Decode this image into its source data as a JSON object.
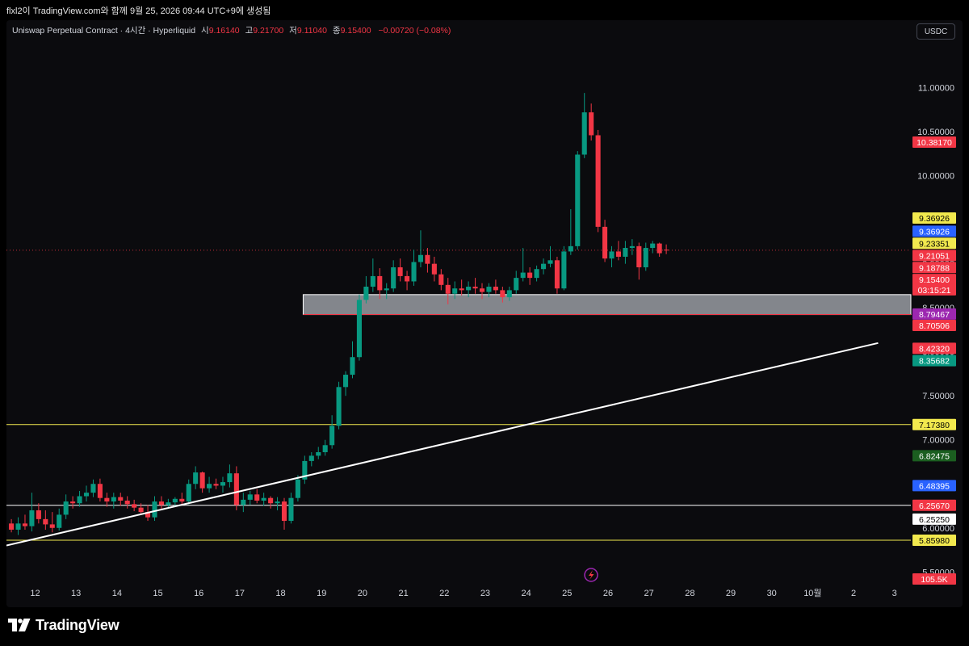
{
  "header": {
    "caption": "flxl2이 TradingView.com와 함께 9월 25, 2026 09:44 UTC+9에 생성됨"
  },
  "legend": {
    "symbol": "Uniswap Perpetual Contract · 4시간 · Hyperliquid",
    "open_label": "시",
    "open_value": "9.16140",
    "high_label": "고",
    "high_value": "9.21700",
    "low_label": "저",
    "low_value": "9.11040",
    "close_label": "종",
    "close_value": "9.15400",
    "change": "−0.00720 (−0.08%)"
  },
  "currency_button": "USDC",
  "footer": {
    "brand": "TradingView"
  },
  "chart_data": {
    "type": "candlestick",
    "title": "Uniswap Perpetual Contract · 4시간 · Hyperliquid",
    "x_ticks": [
      "12",
      "13",
      "14",
      "15",
      "16",
      "17",
      "18",
      "19",
      "20",
      "21",
      "22",
      "23",
      "24",
      "25",
      "26",
      "27",
      "28",
      "29",
      "30",
      "10월",
      "2",
      "3"
    ],
    "y_ticks": [
      "11.00000",
      "10.50000",
      "10.00000",
      "9.50000",
      "9.00000",
      "8.50000",
      "8.00000",
      "7.50000",
      "7.00000",
      "6.50000",
      "6.00000",
      "5.50000"
    ],
    "y_tick_values": [
      11.0,
      10.5,
      10.0,
      9.5,
      9.0,
      8.5,
      8.0,
      7.5,
      7.0,
      6.5,
      6.0,
      5.5
    ],
    "ylim": [
      5.42,
      11.4
    ],
    "xlim": [
      11.3,
      33.4
    ],
    "x_day_values": [
      12,
      13,
      14,
      15,
      16,
      17,
      18,
      19,
      20,
      21,
      22,
      23,
      24,
      25,
      26,
      27,
      28,
      29,
      30,
      31,
      32,
      33
    ],
    "candle_step_days": 0.1667,
    "first_candle_day": 11.42,
    "up_color": "#089981",
    "down_color": "#f23645",
    "ohlc": [
      [
        6.05,
        6.1,
        5.95,
        5.98
      ],
      [
        5.98,
        6.12,
        5.92,
        6.05
      ],
      [
        6.05,
        6.15,
        5.98,
        6.02
      ],
      [
        6.02,
        6.4,
        5.96,
        6.2
      ],
      [
        6.2,
        6.28,
        6.05,
        6.1
      ],
      [
        6.1,
        6.2,
        5.98,
        6.04
      ],
      [
        6.04,
        6.18,
        5.95,
        6.0
      ],
      [
        6.0,
        6.22,
        5.97,
        6.15
      ],
      [
        6.15,
        6.38,
        6.1,
        6.3
      ],
      [
        6.3,
        6.36,
        6.22,
        6.28
      ],
      [
        6.28,
        6.42,
        6.24,
        6.36
      ],
      [
        6.36,
        6.48,
        6.3,
        6.4
      ],
      [
        6.4,
        6.55,
        6.35,
        6.5
      ],
      [
        6.5,
        6.56,
        6.3,
        6.34
      ],
      [
        6.34,
        6.4,
        6.24,
        6.3
      ],
      [
        6.3,
        6.4,
        6.22,
        6.35
      ],
      [
        6.35,
        6.4,
        6.25,
        6.31
      ],
      [
        6.31,
        6.36,
        6.22,
        6.27
      ],
      [
        6.27,
        6.32,
        6.19,
        6.23
      ],
      [
        6.23,
        6.28,
        6.15,
        6.18
      ],
      [
        6.18,
        6.26,
        6.08,
        6.12
      ],
      [
        6.12,
        6.36,
        6.08,
        6.3
      ],
      [
        6.3,
        6.36,
        6.2,
        6.26
      ],
      [
        6.26,
        6.33,
        6.22,
        6.29
      ],
      [
        6.29,
        6.35,
        6.24,
        6.33
      ],
      [
        6.33,
        6.4,
        6.26,
        6.3
      ],
      [
        6.3,
        6.55,
        6.27,
        6.5
      ],
      [
        6.5,
        6.7,
        6.44,
        6.63
      ],
      [
        6.63,
        6.64,
        6.4,
        6.45
      ],
      [
        6.45,
        6.58,
        6.4,
        6.5
      ],
      [
        6.5,
        6.56,
        6.44,
        6.48
      ],
      [
        6.48,
        6.58,
        6.4,
        6.52
      ],
      [
        6.52,
        6.72,
        6.46,
        6.62
      ],
      [
        6.62,
        6.7,
        6.2,
        6.26
      ],
      [
        6.26,
        6.4,
        6.18,
        6.32
      ],
      [
        6.32,
        6.42,
        6.26,
        6.38
      ],
      [
        6.38,
        6.44,
        6.28,
        6.31
      ],
      [
        6.31,
        6.4,
        6.25,
        6.34
      ],
      [
        6.34,
        6.36,
        6.22,
        6.28
      ],
      [
        6.28,
        6.35,
        6.2,
        6.3
      ],
      [
        6.3,
        6.34,
        5.98,
        6.08
      ],
      [
        6.08,
        6.4,
        6.05,
        6.34
      ],
      [
        6.34,
        6.6,
        6.3,
        6.55
      ],
      [
        6.55,
        6.82,
        6.5,
        6.76
      ],
      [
        6.76,
        6.86,
        6.7,
        6.82
      ],
      [
        6.82,
        6.92,
        6.78,
        6.86
      ],
      [
        6.86,
        7.0,
        6.82,
        6.94
      ],
      [
        6.94,
        7.28,
        6.9,
        7.16
      ],
      [
        7.16,
        7.66,
        7.12,
        7.6
      ],
      [
        7.6,
        7.78,
        7.5,
        7.74
      ],
      [
        7.74,
        8.12,
        7.7,
        7.94
      ],
      [
        7.94,
        8.65,
        7.9,
        8.59
      ],
      [
        8.59,
        8.86,
        8.55,
        8.74
      ],
      [
        8.74,
        9.06,
        8.68,
        8.86
      ],
      [
        8.86,
        8.95,
        8.6,
        8.7
      ],
      [
        8.7,
        8.78,
        8.6,
        8.72
      ],
      [
        8.72,
        9.04,
        8.68,
        8.96
      ],
      [
        8.96,
        9.06,
        8.8,
        8.86
      ],
      [
        8.86,
        8.92,
        8.7,
        8.8
      ],
      [
        8.8,
        9.16,
        8.75,
        9.02
      ],
      [
        9.02,
        9.38,
        8.96,
        9.1
      ],
      [
        9.1,
        9.18,
        8.9,
        9.0
      ],
      [
        9.0,
        9.08,
        8.8,
        8.88
      ],
      [
        8.88,
        8.94,
        8.7,
        8.76
      ],
      [
        8.76,
        8.84,
        8.54,
        8.66
      ],
      [
        8.66,
        8.8,
        8.6,
        8.72
      ],
      [
        8.72,
        8.82,
        8.64,
        8.7
      ],
      [
        8.7,
        8.8,
        8.62,
        8.74
      ],
      [
        8.74,
        8.84,
        8.66,
        8.72
      ],
      [
        8.72,
        8.78,
        8.6,
        8.68
      ],
      [
        8.68,
        8.78,
        8.62,
        8.74
      ],
      [
        8.74,
        8.82,
        8.66,
        8.7
      ],
      [
        8.7,
        8.74,
        8.56,
        8.62
      ],
      [
        8.62,
        8.74,
        8.58,
        8.7
      ],
      [
        8.7,
        8.92,
        8.66,
        8.84
      ],
      [
        8.84,
        9.18,
        8.8,
        8.9
      ],
      [
        8.9,
        8.96,
        8.76,
        8.84
      ],
      [
        8.84,
        8.98,
        8.8,
        8.94
      ],
      [
        8.94,
        9.06,
        8.88,
        9.0
      ],
      [
        9.0,
        9.2,
        8.96,
        9.04
      ],
      [
        9.04,
        9.08,
        8.66,
        8.72
      ],
      [
        8.72,
        9.2,
        8.7,
        9.14
      ],
      [
        9.14,
        9.62,
        9.1,
        9.2
      ],
      [
        9.2,
        10.28,
        9.16,
        10.24
      ],
      [
        10.24,
        10.94,
        10.2,
        10.72
      ],
      [
        10.72,
        10.82,
        10.4,
        10.46
      ],
      [
        10.46,
        10.52,
        9.36,
        9.42
      ],
      [
        9.42,
        9.5,
        9.02,
        9.06
      ],
      [
        9.06,
        9.2,
        8.96,
        9.14
      ],
      [
        9.14,
        9.26,
        9.04,
        9.08
      ],
      [
        9.08,
        9.26,
        9.0,
        9.18
      ],
      [
        9.18,
        9.28,
        9.1,
        9.2
      ],
      [
        9.2,
        9.24,
        8.82,
        8.96
      ],
      [
        8.96,
        9.24,
        8.92,
        9.18
      ],
      [
        9.18,
        9.26,
        9.12,
        9.23
      ],
      [
        9.23,
        9.24,
        9.08,
        9.12
      ],
      [
        9.16,
        9.22,
        9.11,
        9.154
      ]
    ],
    "horizontal_lines": [
      {
        "price": 7.1738,
        "color": "#f2e94e"
      },
      {
        "price": 6.2567,
        "color": "#ffffff"
      },
      {
        "price": 5.8598,
        "color": "#f2e94e"
      },
      {
        "price": 9.154,
        "color": "#f23645",
        "style": "dotted"
      }
    ],
    "zone": {
      "top": 8.65,
      "bottom": 8.4232,
      "from_day": 18.55,
      "color": "#b2b5be"
    },
    "trendline": {
      "x1_day": 11.3,
      "y1": 5.8,
      "x2_day": 32.6,
      "y2": 8.1,
      "color": "#ffffff"
    },
    "price_labels": [
      {
        "text": "10.38170",
        "price": 10.3817,
        "bg": "#f23645",
        "fg": "#ffffff"
      },
      {
        "text": "9.36926",
        "price": 9.52,
        "bg": "#f2e94e",
        "fg": "#000000"
      },
      {
        "text": "9.36926",
        "price": 9.37,
        "bg": "#2962ff",
        "fg": "#ffffff"
      },
      {
        "text": "9.23351",
        "price": 9.233,
        "bg": "#f2e94e",
        "fg": "#000000"
      },
      {
        "text": "9.21051",
        "price": 9.095,
        "bg": "#f23645",
        "fg": "#ffffff"
      },
      {
        "text": "9.18788",
        "price": 8.958,
        "bg": "#f23645",
        "fg": "#ffffff"
      },
      {
        "text": "9.15400",
        "price": 8.822,
        "bg": "#f23645",
        "fg": "#ffffff"
      },
      {
        "text": "03:15:21",
        "price": 8.705,
        "bg": "#f23645",
        "fg": "#ffffff"
      },
      {
        "text": "8.79467",
        "price": 8.43,
        "bg": "#9c27b0",
        "fg": "#ffffff"
      },
      {
        "text": "8.70506",
        "price": 8.3,
        "bg": "#f23645",
        "fg": "#ffffff"
      },
      {
        "text": "8.42320",
        "price": 8.04,
        "bg": "#f23645",
        "fg": "#ffffff"
      },
      {
        "text": "8.35682",
        "price": 7.9,
        "bg": "#089981",
        "fg": "#ffffff"
      },
      {
        "text": "7.17380",
        "price": 7.1738,
        "bg": "#f2e94e",
        "fg": "#000000"
      },
      {
        "text": "6.82475",
        "price": 6.82,
        "bg": "#1b5e20",
        "fg": "#ffffff"
      },
      {
        "text": "6.48395",
        "price": 6.48,
        "bg": "#2962ff",
        "fg": "#ffffff"
      },
      {
        "text": "6.25670",
        "price": 6.2567,
        "bg": "#f23645",
        "fg": "#ffffff"
      },
      {
        "text": "6.25250",
        "price": 6.1,
        "bg": "#ffffff",
        "fg": "#000000"
      },
      {
        "text": "5.85980",
        "price": 5.8598,
        "bg": "#f2e94e",
        "fg": "#000000"
      },
      {
        "text": "105.5K",
        "price": 5.42,
        "bg": "#f23645",
        "fg": "#ffffff"
      }
    ],
    "grid": false,
    "legend": "top-left"
  }
}
